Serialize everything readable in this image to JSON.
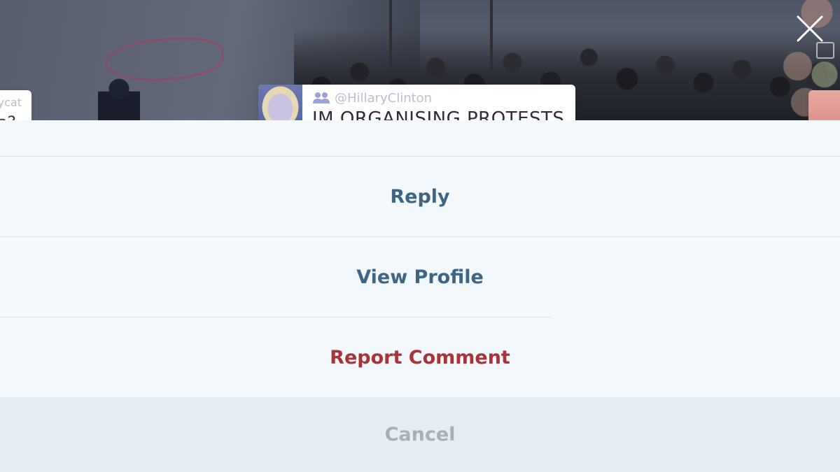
{
  "comment": {
    "handle": "@HillaryClinton",
    "text": "IM ORGANISING PROTESTS"
  },
  "left_comment": {
    "handle_fragment": "ycat",
    "text_fragment": "e?"
  },
  "actions": {
    "reply": "Reply",
    "view_profile": "View Profile",
    "report": "Report Comment",
    "cancel": "Cancel"
  },
  "icons": {
    "close": "close-icon",
    "group": "group-icon",
    "minimize": "minimize-icon"
  },
  "colors": {
    "primary_action": "#3f6583",
    "destructive_action": "#a8343a",
    "cancel_text": "#a9b0b9",
    "sheet_background": "#f3f8fc"
  }
}
